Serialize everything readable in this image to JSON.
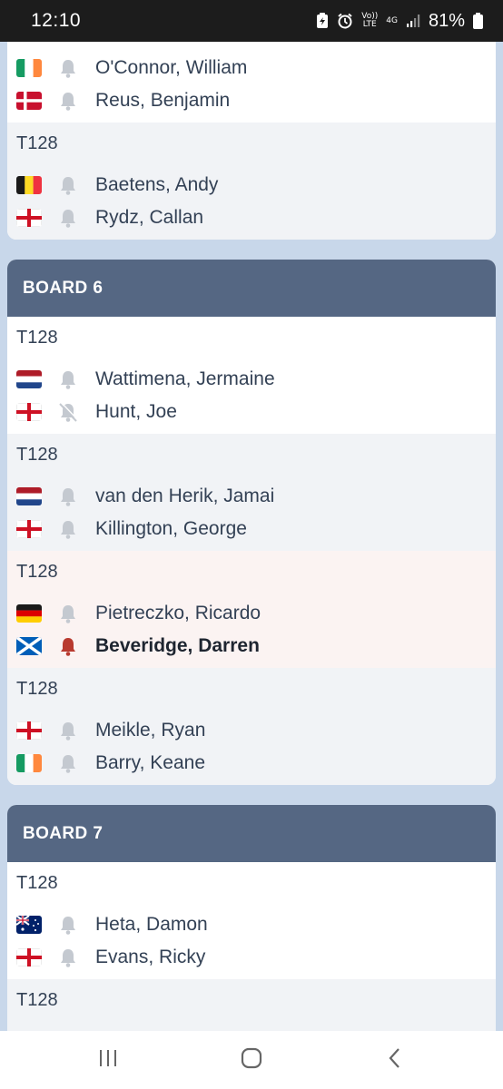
{
  "status_bar": {
    "time": "12:10",
    "network": "4G",
    "volte": "Vo)) LTE",
    "battery": "81%",
    "icons": [
      "battery-saver-icon",
      "alarm-icon",
      "signal-icon",
      "battery-icon"
    ]
  },
  "colors": {
    "page_bg": "#c8d7ea",
    "board_header": "#556783",
    "text": "#334155",
    "bell_muted": "#c4c9d0",
    "bell_active": "#b83a2f",
    "row_grey": "#f1f3f6",
    "row_highlight": "#fbf3f2"
  },
  "boards": [
    {
      "title": "",
      "matches": [
        {
          "round": "T128",
          "bg": "white",
          "players": [
            {
              "flag": "ireland",
              "name": "O'Connor, William",
              "bell": "muted",
              "bold": false
            },
            {
              "flag": "denmark",
              "name": "Reus, Benjamin",
              "bell": "muted",
              "bold": false
            }
          ]
        },
        {
          "round": "T128",
          "bg": "grey",
          "players": [
            {
              "flag": "belgium",
              "name": "Baetens, Andy",
              "bell": "muted",
              "bold": false
            },
            {
              "flag": "england",
              "name": "Rydz, Callan",
              "bell": "muted",
              "bold": false
            }
          ]
        }
      ]
    },
    {
      "title": "BOARD 6",
      "matches": [
        {
          "round": "T128",
          "bg": "white",
          "players": [
            {
              "flag": "netherlands",
              "name": "Wattimena, Jermaine",
              "bell": "muted",
              "bold": false
            },
            {
              "flag": "england",
              "name": "Hunt, Joe",
              "bell": "off",
              "bold": false
            }
          ]
        },
        {
          "round": "T128",
          "bg": "grey",
          "players": [
            {
              "flag": "netherlands",
              "name": "van den Herik, Jamai",
              "bell": "muted",
              "bold": false
            },
            {
              "flag": "england",
              "name": "Killington, George",
              "bell": "muted",
              "bold": false
            }
          ]
        },
        {
          "round": "T128",
          "bg": "pink",
          "players": [
            {
              "flag": "germany",
              "name": "Pietreczko, Ricardo",
              "bell": "muted",
              "bold": false
            },
            {
              "flag": "scotland",
              "name": "Beveridge, Darren",
              "bell": "active",
              "bold": true
            }
          ]
        },
        {
          "round": "T128",
          "bg": "grey",
          "players": [
            {
              "flag": "england",
              "name": "Meikle, Ryan",
              "bell": "muted",
              "bold": false
            },
            {
              "flag": "ireland",
              "name": "Barry, Keane",
              "bell": "muted",
              "bold": false
            }
          ]
        }
      ]
    },
    {
      "title": "BOARD 7",
      "matches": [
        {
          "round": "T128",
          "bg": "white",
          "players": [
            {
              "flag": "australia",
              "name": "Heta, Damon",
              "bell": "muted",
              "bold": false
            },
            {
              "flag": "england",
              "name": "Evans, Ricky",
              "bell": "muted",
              "bold": false
            }
          ]
        },
        {
          "round": "T128",
          "bg": "grey",
          "players": []
        }
      ]
    }
  ],
  "nav_bar": {
    "buttons": [
      "recent-apps-icon",
      "home-icon",
      "back-icon"
    ]
  }
}
